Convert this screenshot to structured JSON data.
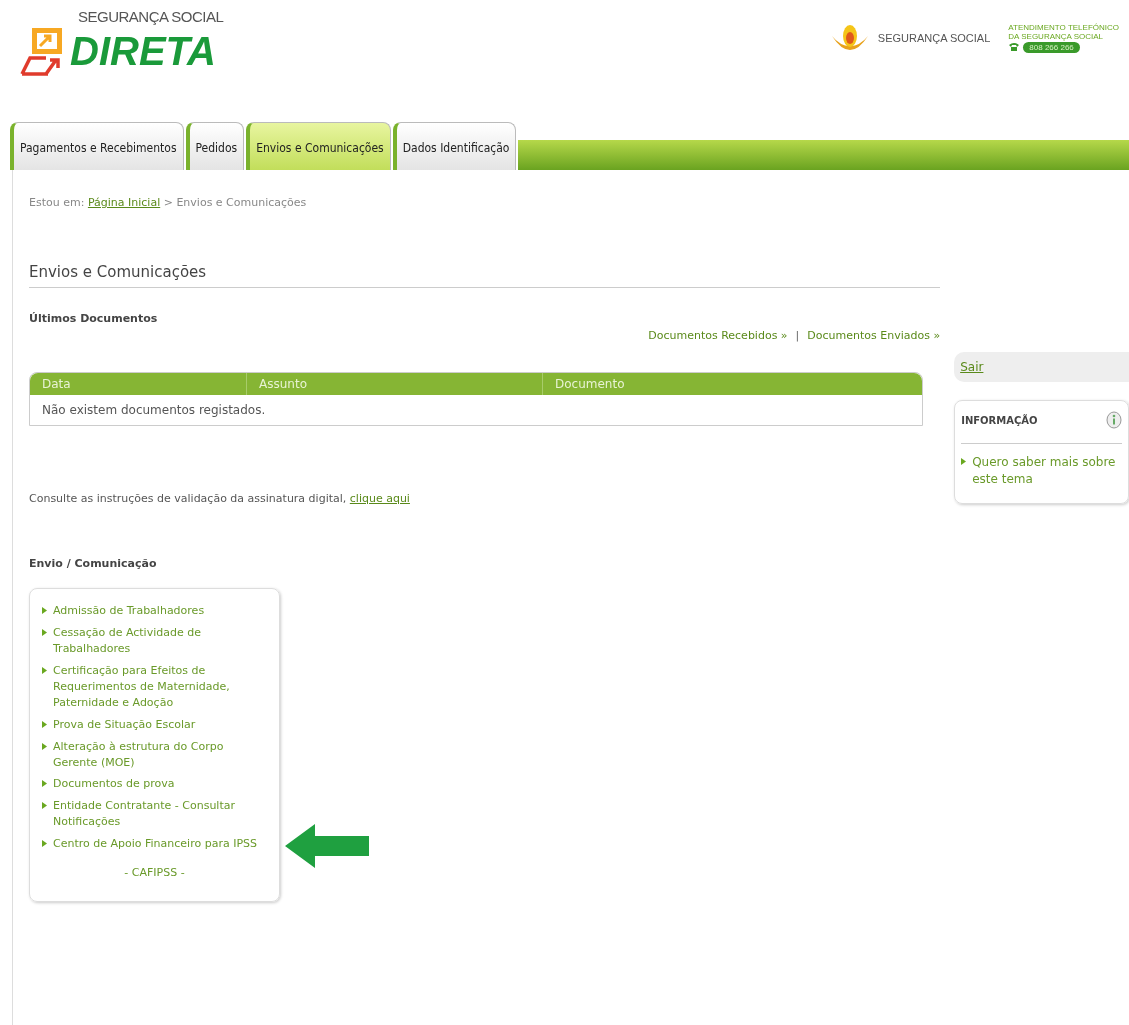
{
  "header": {
    "logo_top": "SEGURANÇA SOCIAL",
    "logo_main": "DIRETA",
    "brand": "SEGURANÇA SOCIAL",
    "helpline_1": "ATENDIMENTO TELEFÓNICO",
    "helpline_2": "DA SEGURANÇA SOCIAL",
    "phone": "808 266 266"
  },
  "tabs": [
    {
      "label": "Pagamentos e Recebimentos",
      "selected": false
    },
    {
      "label": "Pedidos",
      "selected": false
    },
    {
      "label": "Envios e Comunicações",
      "selected": true
    },
    {
      "label": "Dados Identificação",
      "selected": false
    }
  ],
  "breadcrumb": {
    "prefix": "Estou em:",
    "link": "Página Inicial",
    "current": "> Envios e Comunicações"
  },
  "page_title": "Envios e Comunicações",
  "documents": {
    "title": "Últimos Documentos",
    "links": [
      "Documentos Recebidos »",
      "Documentos Enviados »"
    ],
    "separator": "|",
    "columns": [
      "Data",
      "Assunto",
      "Documento"
    ],
    "empty": "Não existem documentos registados."
  },
  "signature_note": {
    "text": "Consulte as instruções de validação da assinatura digital,",
    "link": "clique aqui"
  },
  "submissions": {
    "title": "Envio / Comunicação",
    "items": [
      "Admissão de Trabalhadores",
      "Cessação de Actividade de Trabalhadores",
      "Certificação para Efeitos de Requerimentos de Maternidade, Paternidade e Adoção",
      "Prova de Situação Escolar",
      "Alteração à estrutura do Corpo Gerente (MOE)",
      "Documentos de prova",
      "Entidade Contratante - Consultar Notificações",
      "Centro de Apoio Financeiro para IPSS"
    ],
    "footer": "- CAFIPSS -"
  },
  "sidebar": {
    "logout": "Sair",
    "info_title": "INFORMAÇÃO",
    "info_link": "Quero saber mais sobre este tema"
  }
}
